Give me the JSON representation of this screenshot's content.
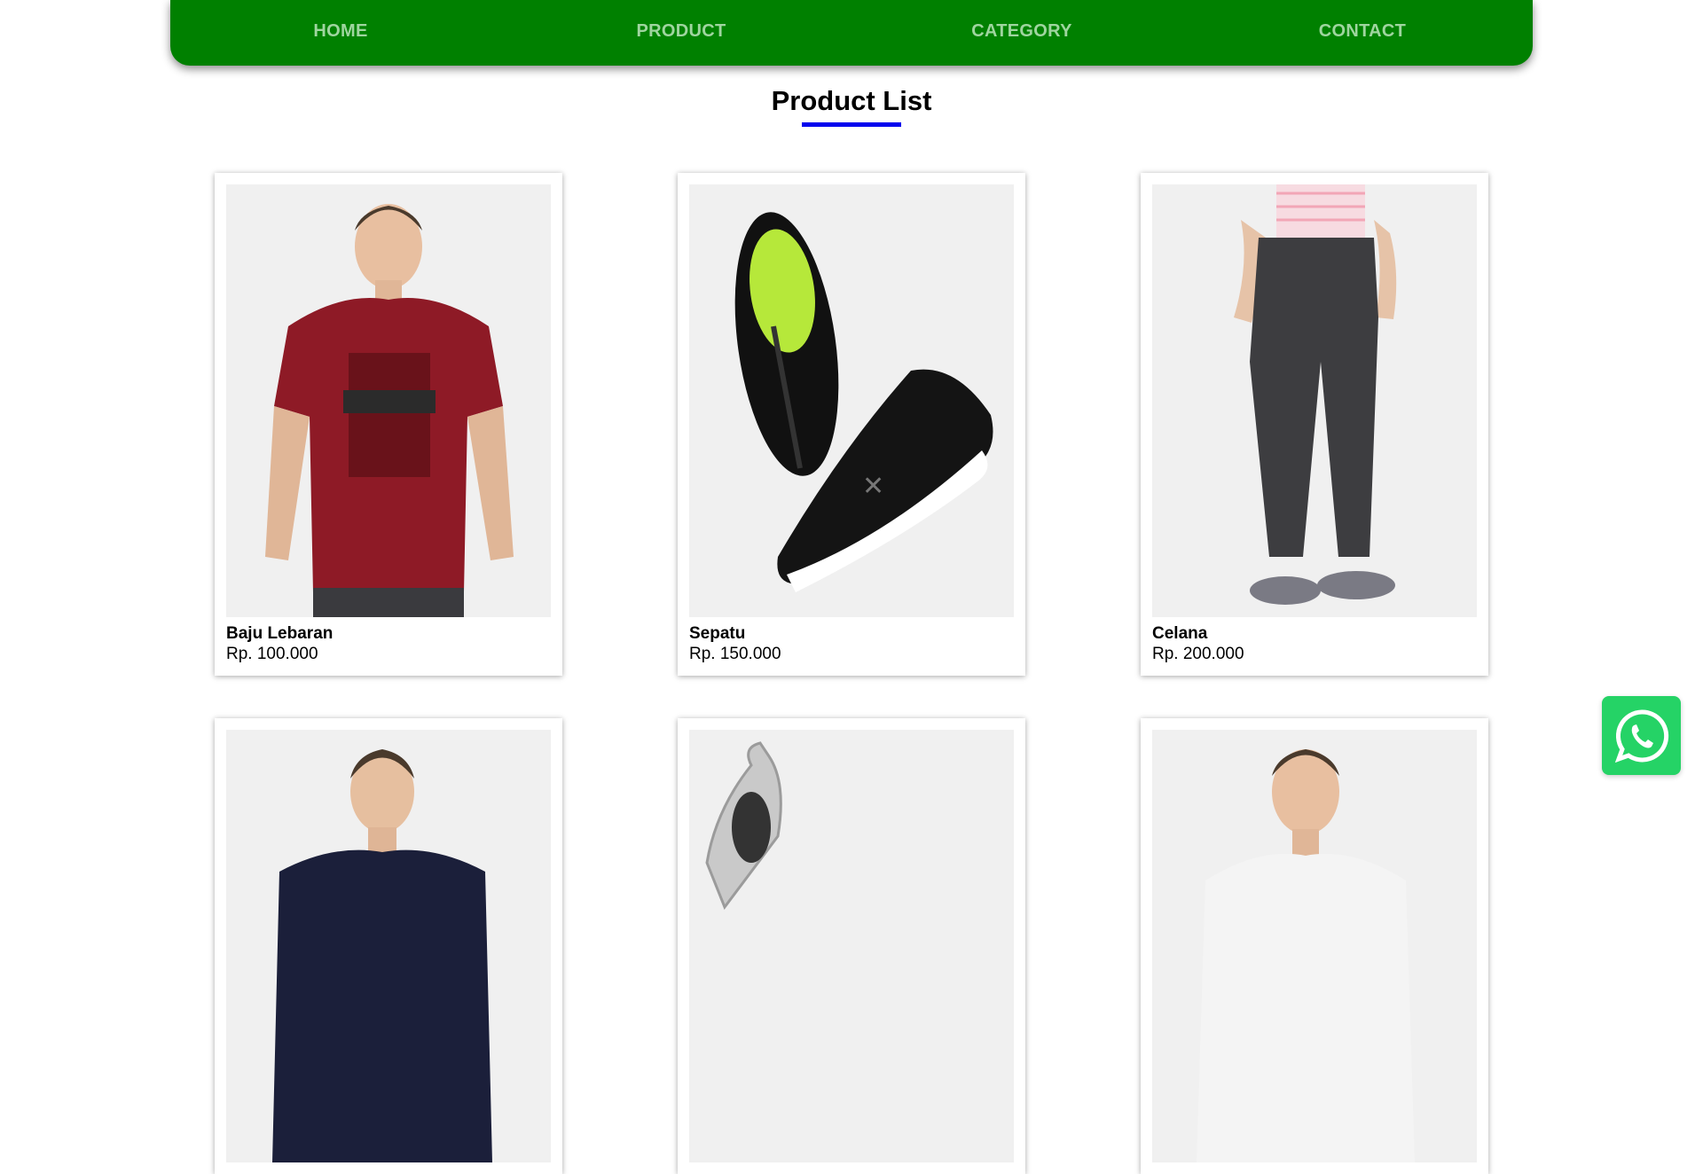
{
  "nav": {
    "items": [
      {
        "label": "HOME"
      },
      {
        "label": "PRODUCT"
      },
      {
        "label": "CATEGORY"
      },
      {
        "label": "CONTACT"
      }
    ]
  },
  "page": {
    "title": "Product List"
  },
  "products": [
    {
      "name": "Baju Lebaran",
      "price": "Rp. 100.000",
      "image": "red-tshirt-model"
    },
    {
      "name": "Sepatu",
      "price": "Rp. 150.000",
      "image": "black-sneakers"
    },
    {
      "name": "Celana",
      "price": "Rp. 200.000",
      "image": "grey-jogger-pants"
    },
    {
      "name": "",
      "price": "",
      "image": "navy-shirt-model"
    },
    {
      "name": "",
      "price": "",
      "image": "grey-high-top-shoe"
    },
    {
      "name": "",
      "price": "",
      "image": "shirt-model"
    }
  ],
  "colors": {
    "nav_bg": "#008000",
    "nav_text": "#9fd59f",
    "underline": "#0000ee",
    "whatsapp": "#25d366"
  },
  "floating": {
    "icon": "whatsapp-icon"
  }
}
